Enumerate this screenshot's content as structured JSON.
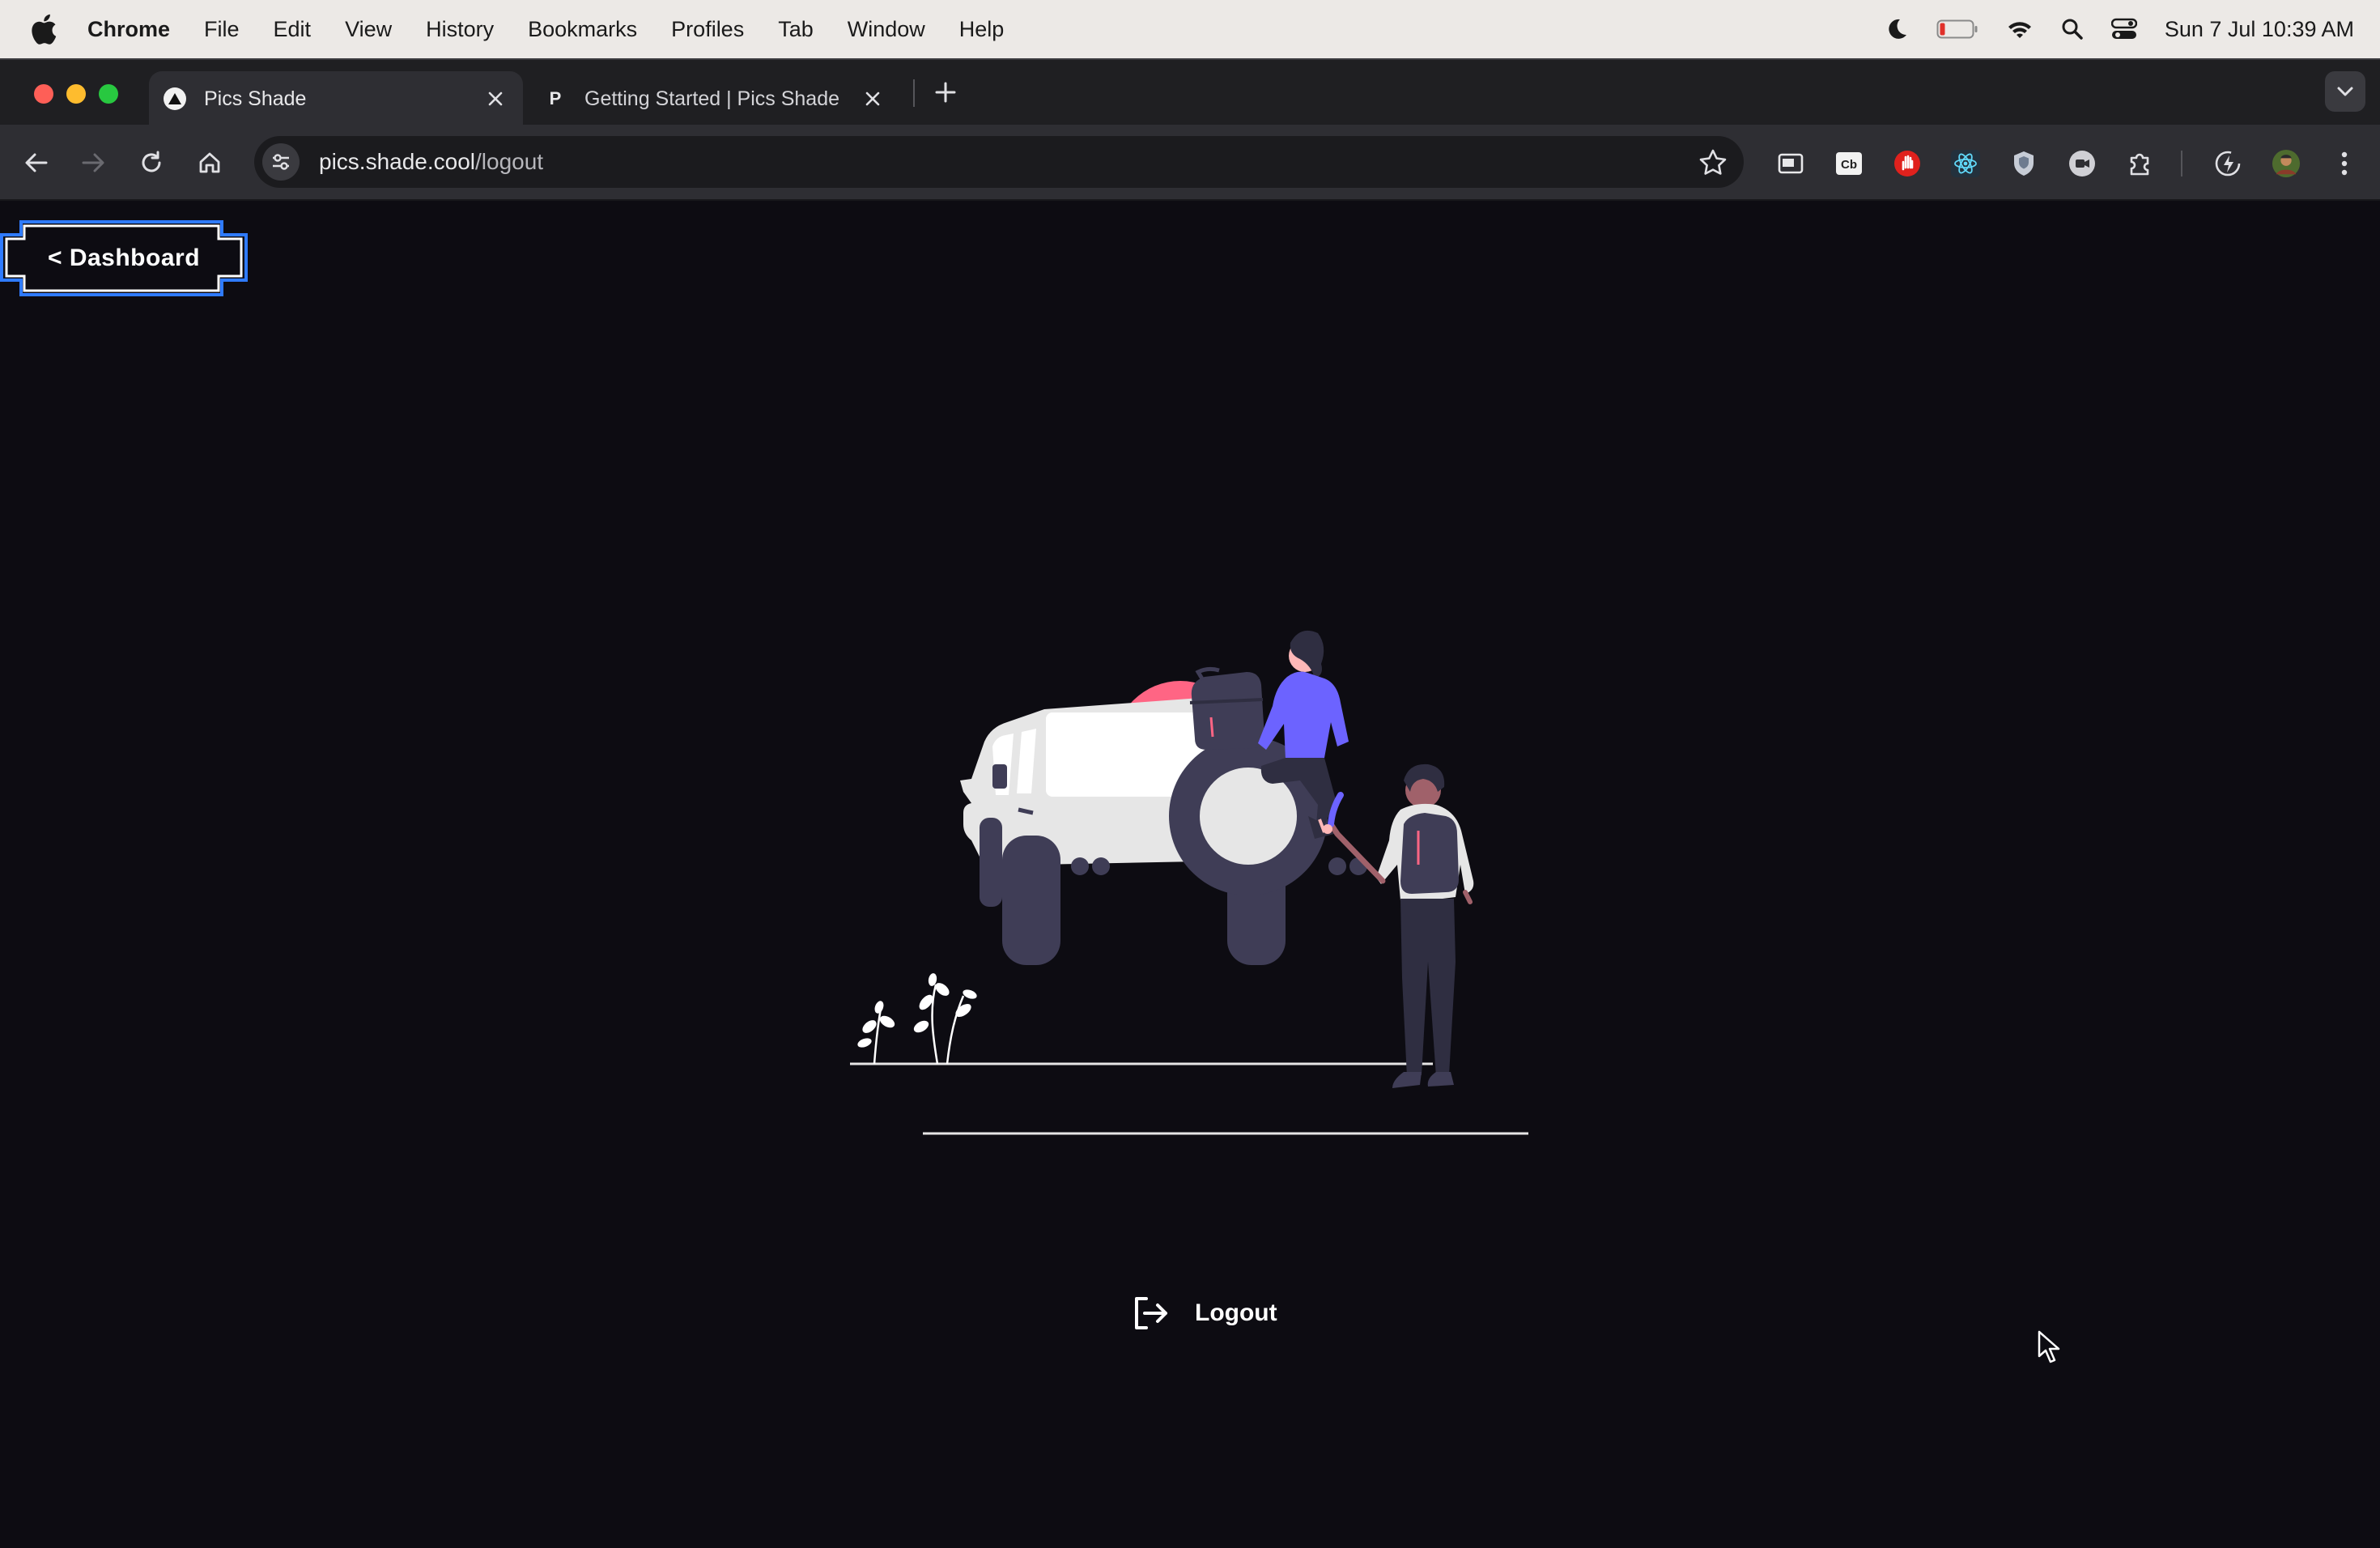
{
  "menubar": {
    "app_name": "Chrome",
    "items": [
      "File",
      "Edit",
      "View",
      "History",
      "Bookmarks",
      "Profiles",
      "Tab",
      "Window",
      "Help"
    ],
    "clock": "Sun 7 Jul  10:39 AM"
  },
  "tabs": [
    {
      "title": "Pics Shade",
      "active": true
    },
    {
      "title": "Getting Started | Pics Shade",
      "active": false,
      "favicon_letter": "P"
    }
  ],
  "address_bar": {
    "host": "pics.shade.cool",
    "path": "/logout"
  },
  "extensions": [
    "picture-in-picture-icon",
    "cb-extension-icon",
    "stop-hand-extension-icon",
    "react-devtools-icon",
    "shield-extension-icon",
    "grey-circle-extension-icon",
    "puzzle-extensions-icon",
    "performance-icon",
    "profile-avatar"
  ],
  "page": {
    "back_button_label": "< Dashboard",
    "logout_label": "Logout",
    "illustration": "couple-jeep-illustration"
  },
  "colors": {
    "page_background": "#0d0c12",
    "dashboard_border": "#2f7bff",
    "accent_purple": "#6c63ff",
    "accent_pink": "#ff6584"
  }
}
